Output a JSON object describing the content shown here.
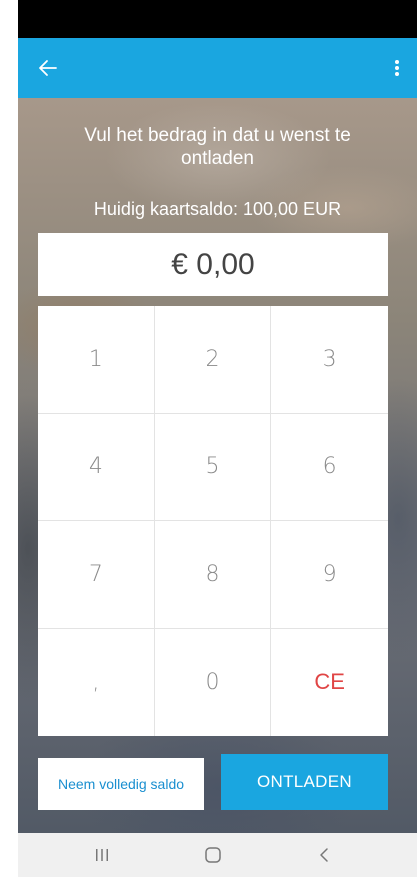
{
  "header": {
    "back_icon": "arrow-left-icon",
    "menu_icon": "more-vertical-icon",
    "accent_color": "#1aa6e0"
  },
  "main": {
    "prompt": "Vul het bedrag in dat u wenst te ontladen",
    "balance": "Huidig kaartsaldo: 100,00 EUR",
    "amount": "€ 0,00"
  },
  "keypad": {
    "keys": [
      "1",
      "2",
      "3",
      "4",
      "5",
      "6",
      "7",
      "8",
      "9",
      ",",
      "0",
      "CE"
    ],
    "ce_color": "#e04545"
  },
  "actions": {
    "full_balance_label": "Neem volledig saldo",
    "discharge_label": "ONTLADEN"
  },
  "navbar": {
    "icons": [
      "recent-apps-icon",
      "home-icon",
      "back-icon"
    ]
  }
}
